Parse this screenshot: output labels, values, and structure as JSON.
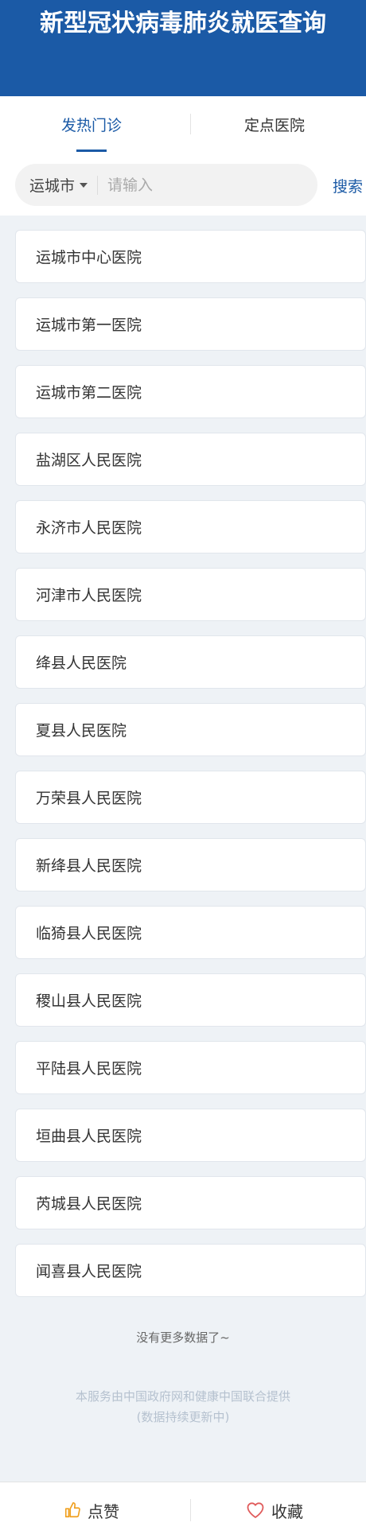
{
  "header": {
    "title": "新型冠状病毒肺炎就医查询"
  },
  "tabs": [
    {
      "label": "发热门诊",
      "active": true
    },
    {
      "label": "定点医院",
      "active": false
    }
  ],
  "search": {
    "city": "运城市",
    "placeholder": "请输入",
    "value": "",
    "button_label": "搜索"
  },
  "hospitals": [
    "运城市中心医院",
    "运城市第一医院",
    "运城市第二医院",
    "盐湖区人民医院",
    "永济市人民医院",
    "河津市人民医院",
    "绛县人民医院",
    "夏县人民医院",
    "万荣县人民医院",
    "新绛县人民医院",
    "临猗县人民医院",
    "稷山县人民医院",
    "平陆县人民医院",
    "垣曲县人民医院",
    "芮城县人民医院",
    "闻喜县人民医院"
  ],
  "list_end": "没有更多数据了~",
  "footer": {
    "line1": "本服务由中国政府网和健康中国联合提供",
    "line2": "(数据持续更新中)"
  },
  "bottom": {
    "like_label": "点赞",
    "favorite_label": "收藏"
  },
  "colors": {
    "brand": "#1b5aa6",
    "like_icon": "#f0a020",
    "favorite_icon": "#e05a5a"
  }
}
